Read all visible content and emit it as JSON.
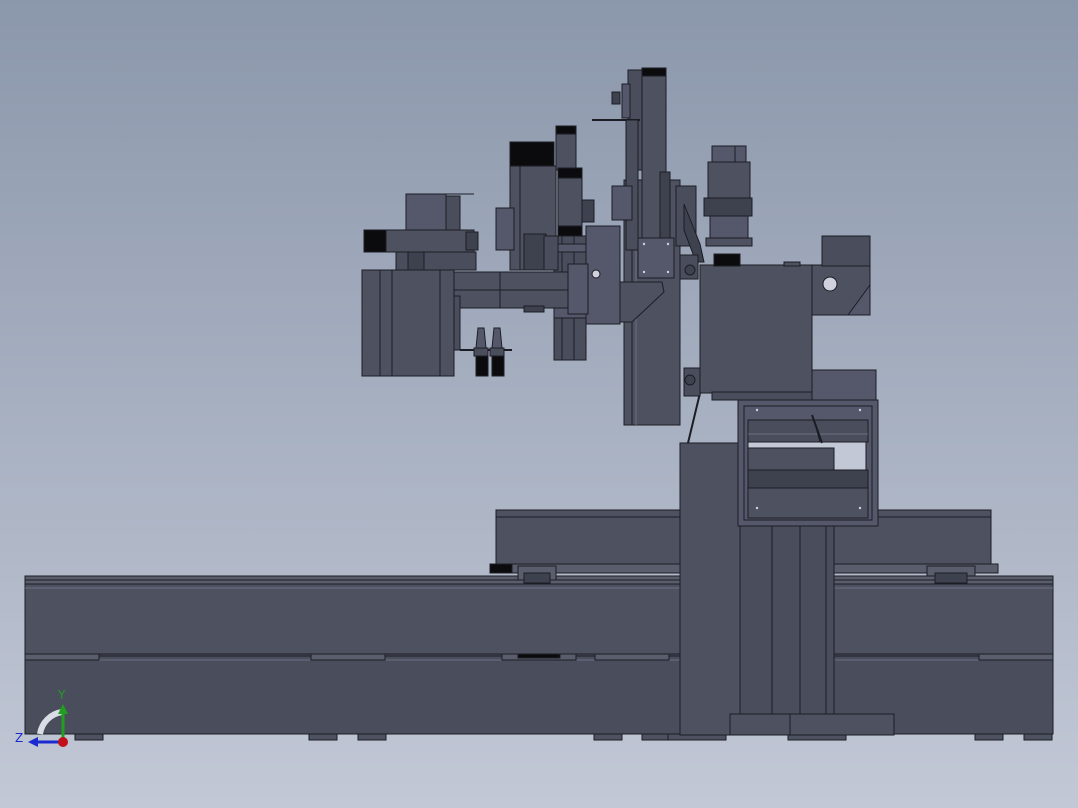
{
  "triad": {
    "x_label": "",
    "y_label": "Y",
    "z_label": "Z"
  },
  "colors": {
    "background_top": "#8b97ab",
    "background_bottom": "#c2c8d6",
    "body_fill": "#4e5160",
    "body_dark": "#3e414e",
    "edge": "#1c1d24",
    "highlight": "#6a6e80",
    "black": "#0b0b0e",
    "light": "#cfd2dc",
    "axis_y": "#1f9e1f",
    "axis_z": "#1a2ad0",
    "origin": "#c0101a"
  }
}
